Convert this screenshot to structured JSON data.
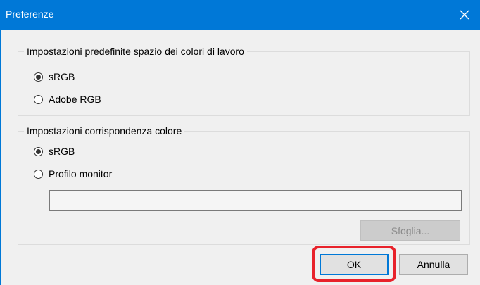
{
  "window": {
    "title": "Preferenze",
    "accent": "#0078d7"
  },
  "group_workspace": {
    "title": "Impostazioni predefinite spazio dei colori di lavoro",
    "options": [
      {
        "label": "sRGB",
        "checked": true
      },
      {
        "label": "Adobe RGB",
        "checked": false
      }
    ]
  },
  "group_matching": {
    "title": "Impostazioni corrispondenza colore",
    "options": [
      {
        "label": "sRGB",
        "checked": true
      },
      {
        "label": "Profilo monitor",
        "checked": false
      }
    ],
    "profile_path_value": "",
    "browse_label": "Sfoglia..."
  },
  "buttons": {
    "ok_label": "OK",
    "cancel_label": "Annulla"
  },
  "highlight_color": "#e8222b"
}
